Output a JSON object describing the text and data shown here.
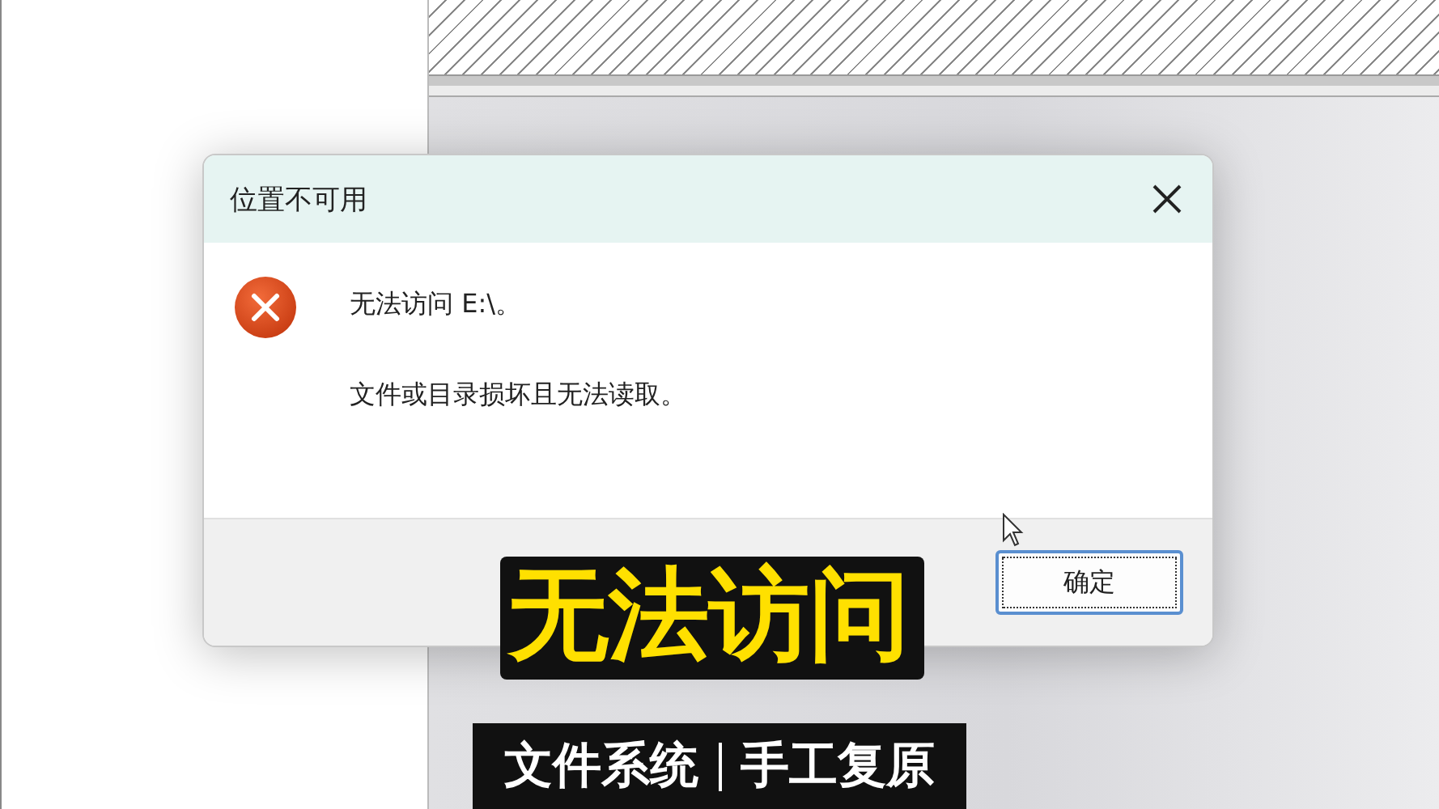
{
  "dialog": {
    "title": "位置不可用",
    "message": "无法访问 E:\\。",
    "detail": "文件或目录损坏且无法读取。",
    "buttons": [
      {
        "label": "确定",
        "default": true
      }
    ]
  },
  "captions": [
    {
      "kind": "headline",
      "texts": [
        "无法访问"
      ]
    },
    {
      "kind": "bar",
      "texts": [
        "文件系统",
        "手工复原"
      ]
    }
  ]
}
